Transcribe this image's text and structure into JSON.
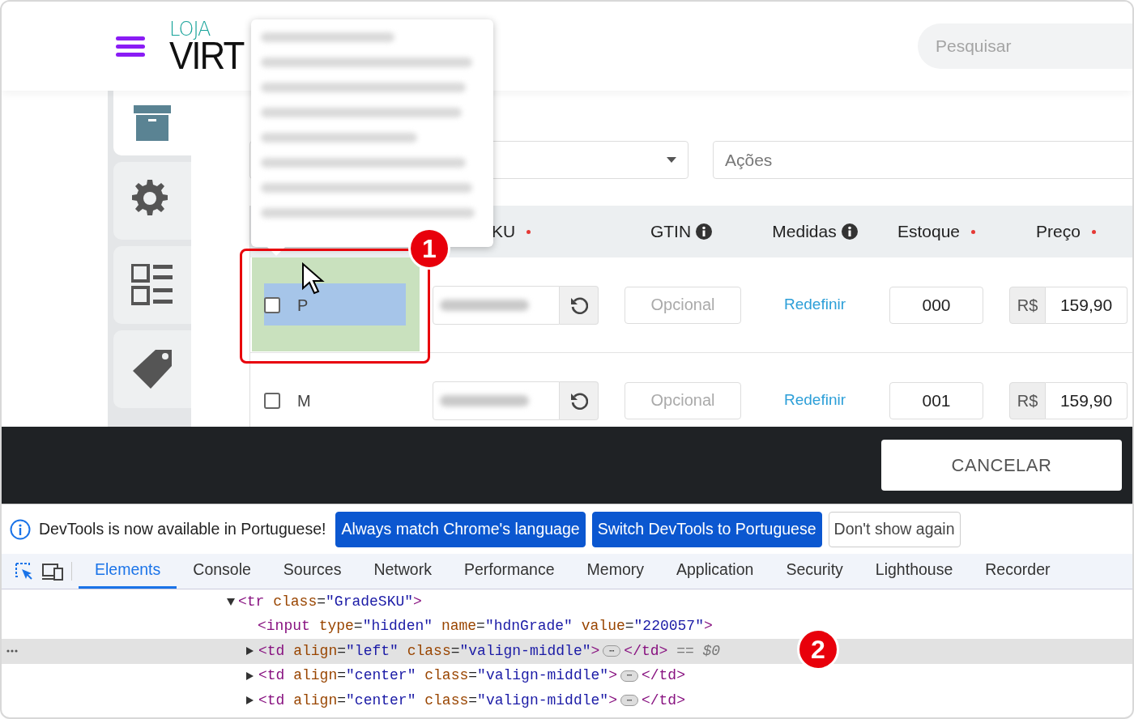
{
  "header": {
    "logo_top": "LOJA",
    "logo_bottom": "VIRT",
    "search": {
      "placeholder": "Pesquisar"
    }
  },
  "sidebar": {
    "items": [
      {
        "kind": "archive",
        "selected": true
      },
      {
        "kind": "gear",
        "selected": false
      },
      {
        "kind": "grid",
        "selected": false
      },
      {
        "kind": "tag",
        "selected": false
      }
    ]
  },
  "filters": {
    "actions_select": "Ações"
  },
  "inspect_tooltip": {
    "visible": true
  },
  "table": {
    "columns": [
      {
        "label": "KU",
        "required": true,
        "info": false
      },
      {
        "label": "GTIN",
        "required": false,
        "info": true
      },
      {
        "label": "Medidas",
        "required": false,
        "info": true
      },
      {
        "label": "Estoque",
        "required": true,
        "info": false
      },
      {
        "label": "Preço",
        "required": true,
        "info": false
      }
    ],
    "rows": [
      {
        "label": "P",
        "checked": false,
        "highlighted": true,
        "sku_redacted": true,
        "gtin_placeholder": "Opcional",
        "medidas_link": "Redefinir",
        "stock": "000",
        "currency": "R$",
        "price": "159,90"
      },
      {
        "label": "M",
        "checked": false,
        "highlighted": false,
        "sku_redacted": true,
        "gtin_placeholder": "Opcional",
        "medidas_link": "Redefinir",
        "stock": "001",
        "currency": "R$",
        "price": "159,90"
      }
    ]
  },
  "footer_bar": {
    "cancel": "CANCELAR"
  },
  "devtools": {
    "infobar": {
      "message": "DevTools is now available in Portuguese!",
      "buttons": [
        {
          "label": "Always match Chrome's language",
          "kind": "primary"
        },
        {
          "label": "Switch DevTools to Portuguese",
          "kind": "primary"
        },
        {
          "label": "Don't show again",
          "kind": "secondary"
        }
      ]
    },
    "tabs": [
      {
        "label": "Elements",
        "selected": true
      },
      {
        "label": "Console",
        "selected": false
      },
      {
        "label": "Sources",
        "selected": false
      },
      {
        "label": "Network",
        "selected": false
      },
      {
        "label": "Performance",
        "selected": false
      },
      {
        "label": "Memory",
        "selected": false
      },
      {
        "label": "Application",
        "selected": false
      },
      {
        "label": "Security",
        "selected": false
      },
      {
        "label": "Lighthouse",
        "selected": false
      },
      {
        "label": "Recorder",
        "selected": false
      }
    ],
    "dom": [
      {
        "expanded": true,
        "selected": false,
        "tokens": [
          {
            "kind": "tag",
            "text": "<tr "
          },
          {
            "kind": "attr",
            "text": "class"
          },
          {
            "kind": "punct",
            "text": "="
          },
          {
            "kind": "value",
            "text": "\"GradeSKU\""
          },
          {
            "kind": "tag",
            "text": ">"
          }
        ],
        "children": [
          {
            "selected": false,
            "tokens": [
              {
                "kind": "tag",
                "text": "<input "
              },
              {
                "kind": "attr",
                "text": "type"
              },
              {
                "kind": "punct",
                "text": "="
              },
              {
                "kind": "value",
                "text": "\"hidden\" "
              },
              {
                "kind": "attr",
                "text": "name"
              },
              {
                "kind": "punct",
                "text": "="
              },
              {
                "kind": "value",
                "text": "\"hdnGrade\" "
              },
              {
                "kind": "attr",
                "text": "value"
              },
              {
                "kind": "punct",
                "text": "="
              },
              {
                "kind": "value",
                "text": "\"220057\""
              },
              {
                "kind": "tag",
                "text": ">"
              }
            ]
          },
          {
            "expanded": false,
            "selected": true,
            "tokens": [
              {
                "kind": "tag",
                "text": "<td "
              },
              {
                "kind": "attr",
                "text": "align"
              },
              {
                "kind": "punct",
                "text": "="
              },
              {
                "kind": "value",
                "text": "\"left\" "
              },
              {
                "kind": "attr",
                "text": "class"
              },
              {
                "kind": "punct",
                "text": "="
              },
              {
                "kind": "value",
                "text": "\"valign-middle\""
              },
              {
                "kind": "tag",
                "text": ">"
              },
              {
                "kind": "ellipsis",
                "text": "⋯"
              },
              {
                "kind": "tag",
                "text": "</td>"
              },
              {
                "kind": "note",
                "text": " == $0"
              }
            ]
          },
          {
            "expanded": false,
            "selected": false,
            "tokens": [
              {
                "kind": "tag",
                "text": "<td "
              },
              {
                "kind": "attr",
                "text": "align"
              },
              {
                "kind": "punct",
                "text": "="
              },
              {
                "kind": "value",
                "text": "\"center\" "
              },
              {
                "kind": "attr",
                "text": "class"
              },
              {
                "kind": "punct",
                "text": "="
              },
              {
                "kind": "value",
                "text": "\"valign-middle\""
              },
              {
                "kind": "tag",
                "text": ">"
              },
              {
                "kind": "ellipsis",
                "text": "⋯"
              },
              {
                "kind": "tag",
                "text": "</td>"
              }
            ]
          },
          {
            "expanded": false,
            "selected": false,
            "tokens": [
              {
                "kind": "tag",
                "text": "<td "
              },
              {
                "kind": "attr",
                "text": "align"
              },
              {
                "kind": "punct",
                "text": "="
              },
              {
                "kind": "value",
                "text": "\"center\" "
              },
              {
                "kind": "attr",
                "text": "class"
              },
              {
                "kind": "punct",
                "text": "="
              },
              {
                "kind": "value",
                "text": "\"valign-middle\""
              },
              {
                "kind": "tag",
                "text": ">"
              },
              {
                "kind": "ellipsis",
                "text": "⋯"
              },
              {
                "kind": "tag",
                "text": "</td>"
              }
            ]
          }
        ]
      }
    ]
  },
  "annotations": [
    {
      "label": "1"
    },
    {
      "label": "2"
    }
  ]
}
